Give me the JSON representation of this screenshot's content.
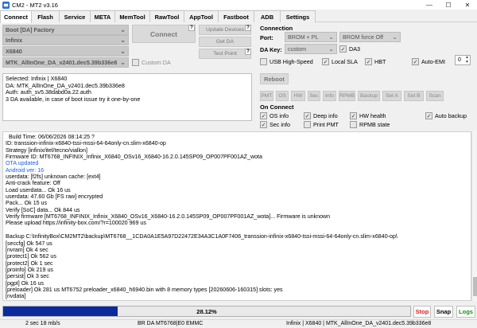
{
  "window": {
    "title": "CM2 - MT2 v3.16",
    "minimize": "—",
    "maximize": "☐",
    "close": "✕"
  },
  "tabs": [
    {
      "label": "Connect",
      "active": true
    },
    {
      "label": "Flash"
    },
    {
      "label": "Service"
    },
    {
      "label": "META"
    },
    {
      "label": "MemTool"
    },
    {
      "label": "RawTool"
    },
    {
      "label": "AppTool"
    },
    {
      "label": "Fastboot"
    },
    {
      "label": "ADB"
    },
    {
      "label": "Settings"
    }
  ],
  "left": {
    "boot_select": "Boot [DA] Factory",
    "brand_select": "Infinix",
    "model_select": "X6840",
    "da_select": "MTK_AllInOne_DA_v2401.dec5.39b336e8",
    "connect_button": "Connect",
    "update_devices_button": "Update Devices",
    "get_da_button": "Get DA",
    "test_point_button": "Test Point",
    "custom_da_label": "Custom DA",
    "help_badge": "?"
  },
  "selection_info": [
    "Selected: Infinix | X6840",
    "DA: MTK_AllInOne_DA_v2401.dec5.39b336e8",
    "Auth: auth_sv5.38dabd0a.22.auth",
    "3 DA available, in case of boot issue try it one-by-one"
  ],
  "connection": {
    "title": "Connection",
    "port_label": "Port:",
    "port_value": "BROM + PL",
    "port_mode": "BROM force Off",
    "da_key_label": "DA Key:",
    "da_key_value": "custom",
    "da3_label": "DA3",
    "usb_high_speed": "USB High-Speed",
    "local_sla": "Local SLA",
    "hbt": "HBT",
    "auto_emi": "Auto-EMI",
    "auto_emi_value": "0",
    "reboot_button": "Reboot",
    "mini_buttons": [
      "PMT",
      "OS",
      "HW",
      "Sec",
      "Info",
      "RPMB",
      "Backup",
      "Set A",
      "Set B",
      "Scan"
    ]
  },
  "on_connect": {
    "title": "On Connect",
    "os_info": "OS info",
    "deep_info": "Deep info",
    "auto_backup": "Auto backup",
    "sec_info": "Sec info",
    "print_pmt": "Print PMT",
    "hw_health": "HW health",
    "rpmb_state": "RPMB state"
  },
  "log": [
    {
      "t": "  Build Time: 06/06/2026 08:14:25 ?"
    },
    {
      "t": "ID: transsion-infinix-x6840-tssi-mssi-64-64only-cn.slim-x6840-op"
    },
    {
      "t": "Strategy [infinix/itel/tecno/viallon]"
    },
    {
      "t": "Firmware ID: MT6768_INFINIX_Infinix_X6840_OSv16_X6840-16.2.0.145SP09_OP007PF001AZ_wota"
    },
    {
      "t": "OTA updated",
      "c": "blue"
    },
    {
      "t": "Android ver: 16",
      "c": "blue"
    },
    {
      "t": "userdata: [f2fs] unknown cache: [ext4]"
    },
    {
      "t": "Anti-crack feature: Off"
    },
    {
      "t": "Load userdata... Ok 16 us"
    },
    {
      "t": "userdata: 47.60 Gb [FS raw] encrypted"
    },
    {
      "t": "Pack... Ok 15 us"
    },
    {
      "t": "Verify [SoC] data... Ok 844 us"
    },
    {
      "t": "Verify firmware [MT6768_INFINIX_Infinix_X6840_OSv16_X6840-16.2.0.145SP09_OP007PF001AZ_wota]... Firmware is unknown"
    },
    {
      "t": "Please upload https://infinity-box.com/?r=100020 969 us"
    },
    {
      "t": ""
    },
    {
      "t": "Backup C:\\InfinityBox\\CM2MT2\\backup\\MT6768__1CDA0A1E5A97D22472E34A3C1A0F7406_transsion-infinix-x6840-tssi-mssi-64-64only-cn.slim-x6840-op\\"
    },
    {
      "t": "[seccfg] Ok 547 us"
    },
    {
      "t": "[nvram] Ok 4 sec"
    },
    {
      "t": "[protect1] Ok 562 us"
    },
    {
      "t": "[protect2] Ok 1 sec"
    },
    {
      "t": "[proinfo] Ok 219 us"
    },
    {
      "t": "[persist] Ok 3 sec"
    },
    {
      "t": "[pgpt] Ok 16 us"
    },
    {
      "t": "[preloader] Ok 281 us MT6752 preloader_x6840_h6940.bin with 8 memory types [20260606-160315] slots: yes"
    },
    {
      "t": "[nvdata]"
    }
  ],
  "progress": {
    "text": "28.12%",
    "fraction": 0.2812
  },
  "actions": {
    "stop": "Stop",
    "snap": "Snap",
    "logs": "Logs"
  },
  "status": {
    "timing": "2 sec 18 mb/s",
    "chip": "BR DA MT6768|E0 EMMC",
    "device": "Infinix | X6840 | MTK_AllInOne_DA_v2401.dec5.39b336e8"
  },
  "colors": {
    "progress_fill": "#0a2a9e",
    "stop": "#d62020",
    "snap": "#000000",
    "logs": "#1a8f1a",
    "log_blue": "#1f5ce6"
  }
}
